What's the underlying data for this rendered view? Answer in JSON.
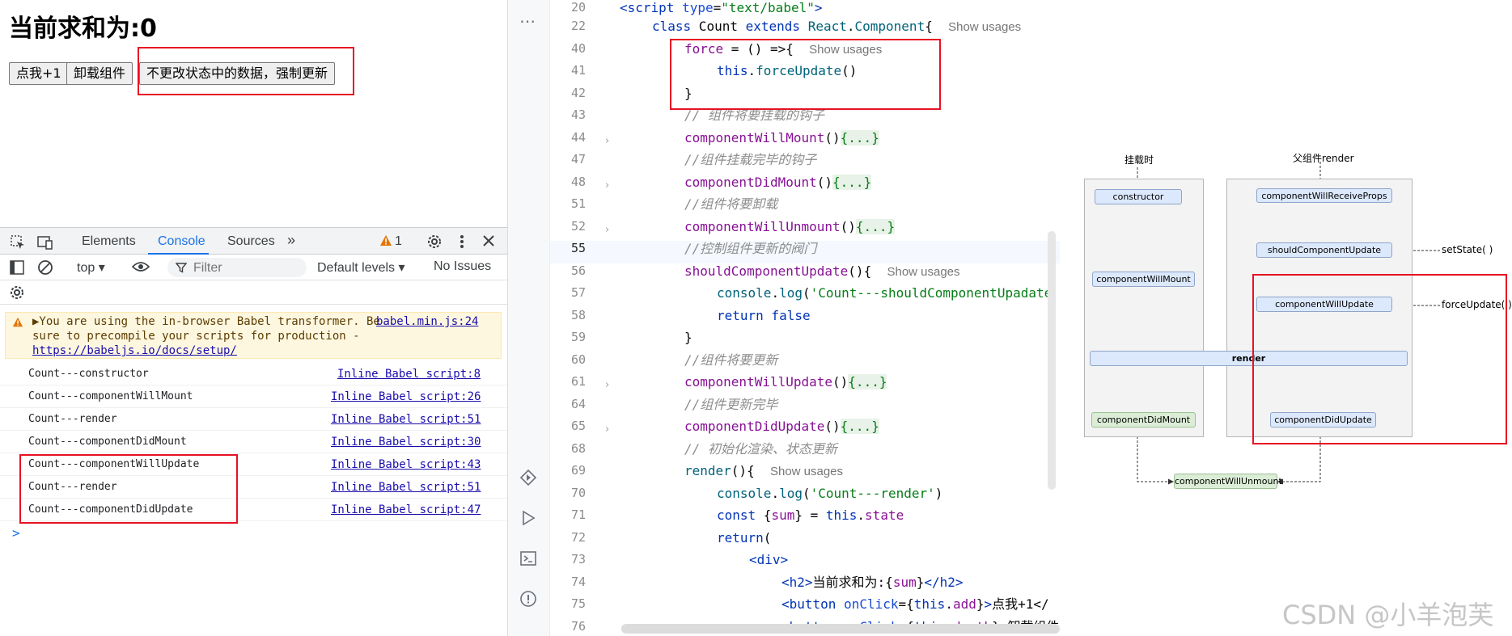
{
  "app": {
    "title": "当前求和为:0",
    "buttons": [
      "点我+1",
      "卸载组件",
      "不更改状态中的数据，强制更新"
    ]
  },
  "devtools": {
    "tabs": [
      "Elements",
      "Console",
      "Sources"
    ],
    "warning_count": "1",
    "context": "top",
    "filter_placeholder": "Filter",
    "levels": "Default levels",
    "issues": "No Issues",
    "warning": {
      "line1": "▶You are using the in-browser Babel transformer. Be",
      "source": "babel.min.js:24",
      "line2": "sure to precompile your scripts for production -",
      "link": "https://babeljs.io/docs/setup/"
    },
    "logs": [
      {
        "msg": "Count---constructor",
        "src": "Inline Babel script:8"
      },
      {
        "msg": "Count---componentWillMount",
        "src": "Inline Babel script:26"
      },
      {
        "msg": "Count---render",
        "src": "Inline Babel script:51"
      },
      {
        "msg": "Count---componentDidMount",
        "src": "Inline Babel script:30"
      },
      {
        "msg": "Count---componentWillUpdate",
        "src": "Inline Babel script:43"
      },
      {
        "msg": "Count---render",
        "src": "Inline Babel script:51"
      },
      {
        "msg": "Count---componentDidUpdate",
        "src": "Inline Babel script:47"
      }
    ],
    "prompt": ">"
  },
  "code": {
    "lines": [
      "20",
      "22",
      "40",
      "41",
      "42",
      "43",
      "44",
      "47",
      "48",
      "51",
      "52",
      "55",
      "56",
      "57",
      "58",
      "59",
      "60",
      "61",
      "64",
      "65",
      "68",
      "69",
      "70",
      "71",
      "72",
      "73",
      "74",
      "75",
      "76"
    ],
    "show_usages": "Show usages",
    "comments": {
      "c43": "// 组件将要挂载的钩子",
      "c47": "//组件挂载完毕的钩子",
      "c51": "//组件将要卸载",
      "c55": "//控制组件更新的阀门",
      "c60": "//组件将要更新",
      "c64": "//组件更新完毕",
      "c68": "// 初始化渲染、状态更新"
    },
    "strings": {
      "s57": "'Count---shouldComponentUpadate",
      "s70": "'Count---render'"
    },
    "h2_text": "当前求和为:",
    "btn75_text": "点我+1</",
    "btn76_text": "卸载组件"
  },
  "diagram": {
    "left_title": "挂载时",
    "right_title": "父组件render",
    "nodes": {
      "constructor": "constructor",
      "componentWillMount": "componentWillMount",
      "render": "render",
      "componentDidMount": "componentDidMount",
      "componentWillReceiveProps": "componentWillReceiveProps",
      "shouldComponentUpdate": "shouldComponentUpdate",
      "componentWillUpdate": "componentWillUpdate",
      "componentDidUpdate": "componentDidUpdate",
      "componentWillUnmount": "componentWillUnmount"
    },
    "setState_label": "setState( )",
    "forceUpdate_label": "forceUpdate( )"
  },
  "watermark": "CSDN @小羊泡芙",
  "colors": {
    "highlight_box": "#e81123",
    "console_tab": "#1a73e8"
  }
}
